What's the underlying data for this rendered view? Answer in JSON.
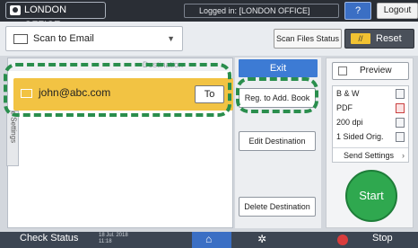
{
  "topbar": {
    "office": "LONDON OFFICE",
    "logged_in": "Logged in: [LONDON OFFICE]",
    "help_label": "?",
    "logout_label": "Logout",
    "moon_glyph": "☾"
  },
  "function_bar": {
    "selected_function": "Scan to Email",
    "scan_files_status_label": "Scan Files Status",
    "reset_label": "Reset"
  },
  "destination_panel": {
    "header": "Destination",
    "entry_address": "john@abc.com",
    "to_label": "To",
    "side_tab_label": "o Settings",
    "highlight_color": "#f2c343"
  },
  "actions": {
    "exit_label": "Exit",
    "reg_addbook_label": "Reg. to Add. Book",
    "edit_destination_label": "Edit Destination",
    "delete_destination_label": "Delete Destination"
  },
  "right_panel": {
    "preview_label": "Preview",
    "settings": [
      "B & W",
      "PDF",
      "200 dpi",
      "1 Sided Orig."
    ],
    "send_settings_label": "Send Settings",
    "start_label": "Start",
    "start_color": "#2fa84f"
  },
  "bottombar": {
    "check_status_label": "Check Status",
    "date": "18 Jul. 2018",
    "time": "11:18",
    "home_glyph": "⌂",
    "gear_glyph": "✲",
    "stop_label": "Stop"
  },
  "annotation_color": "#2a8e4d"
}
